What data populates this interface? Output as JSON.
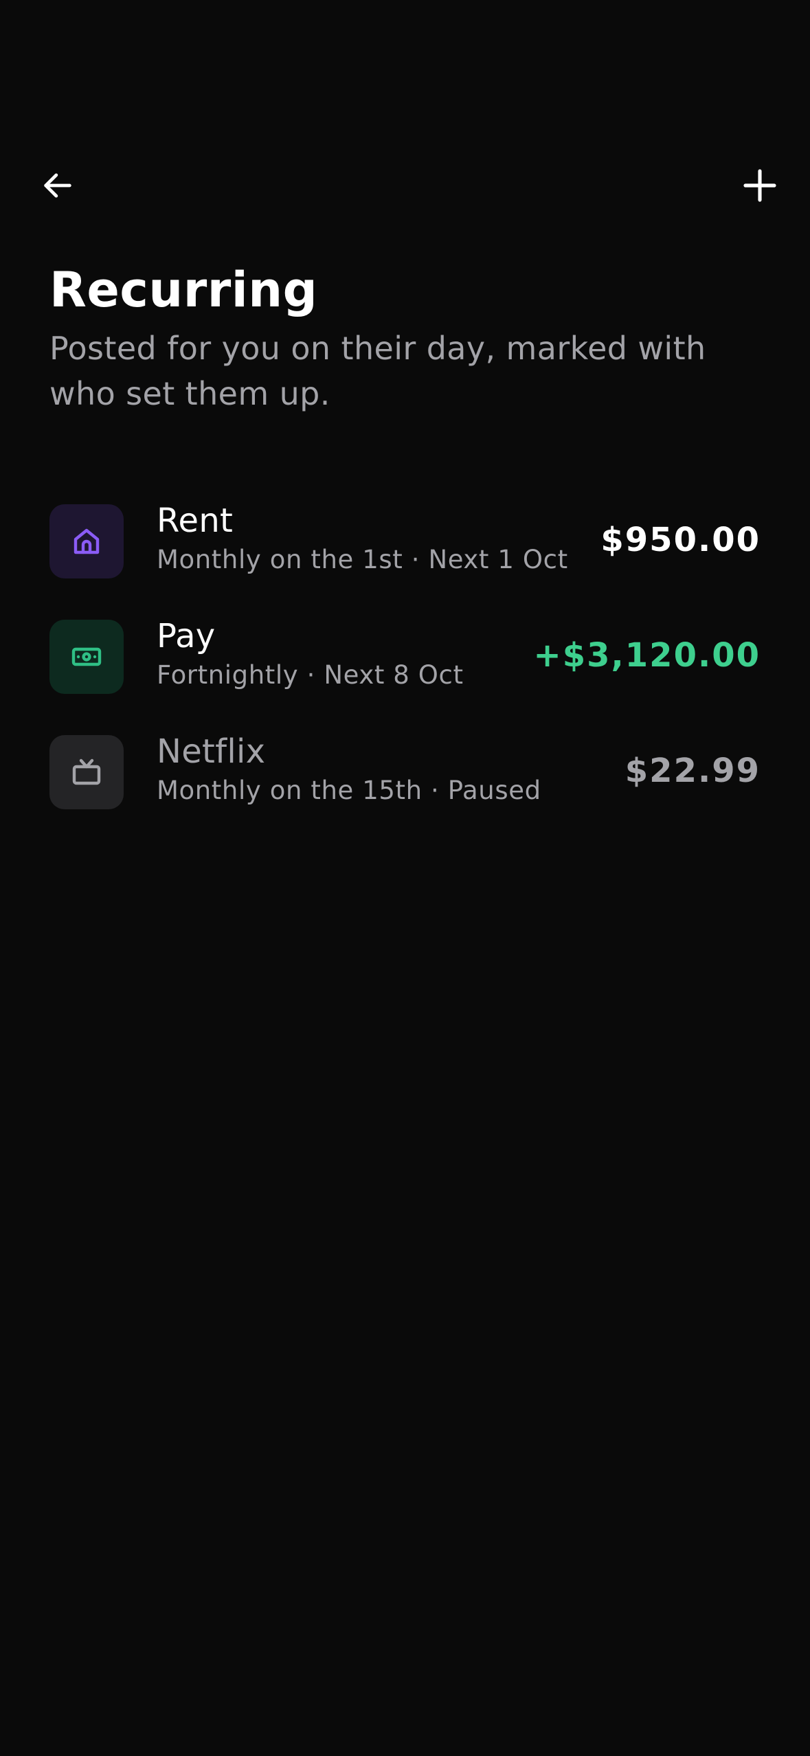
{
  "header": {
    "back_icon": "arrow-left-icon",
    "add_icon": "plus-icon",
    "title": "Recurring",
    "subtitle": "Posted for you on their day, marked with who set them up."
  },
  "colors": {
    "background": "#0a0a0a",
    "text_primary": "#ffffff",
    "text_secondary": "#a3a3a8",
    "income": "#3ecf8e",
    "rent_icon": "#8b5cf6",
    "rent_icon_bg": "#1e1631",
    "pay_icon": "#2fbf85",
    "pay_icon_bg": "#0d2a1f",
    "netflix_icon": "#a3a3a8",
    "netflix_icon_bg": "#242426"
  },
  "items": [
    {
      "icon": "house-icon",
      "title": "Rent",
      "subtitle": "Monthly on the 1st · Next 1 Oct",
      "amount": "$950.00"
    },
    {
      "icon": "cash-icon",
      "title": "Pay",
      "subtitle": "Fortnightly · Next 8 Oct",
      "amount": "+$3,120.00"
    },
    {
      "icon": "tv-icon",
      "title": "Netflix",
      "subtitle": "Monthly on the 15th · Paused",
      "amount": "$22.99"
    }
  ]
}
